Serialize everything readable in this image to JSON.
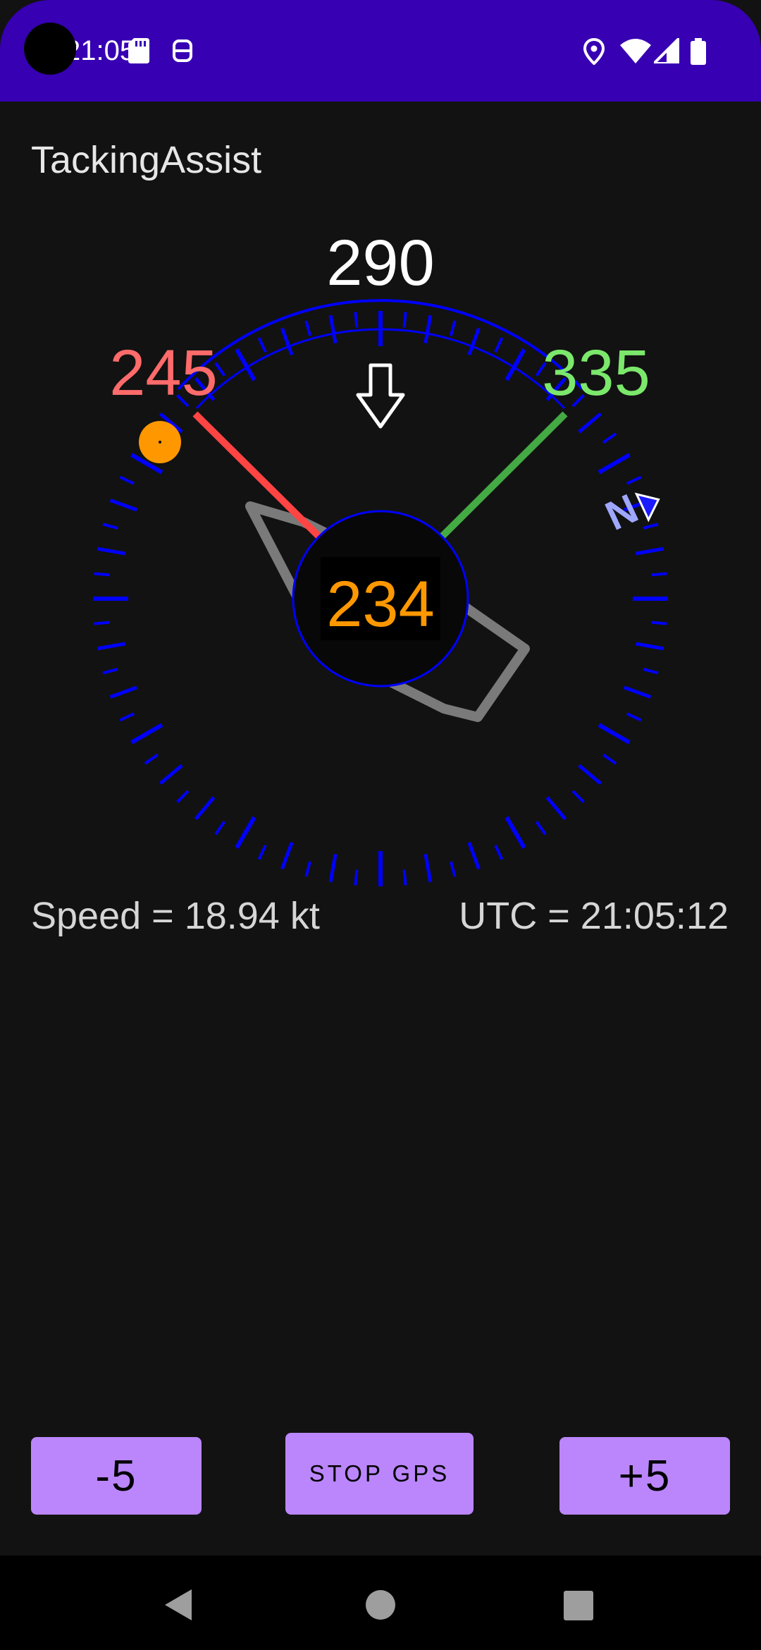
{
  "status_bar": {
    "time": "21:05",
    "icons": [
      "sd-card-icon",
      "robot-icon",
      "location-icon",
      "wifi-icon",
      "signal-icon",
      "battery-icon"
    ]
  },
  "app": {
    "title": "TackingAssist"
  },
  "compass": {
    "target_heading": "290",
    "port_tack": "245",
    "starboard_tack": "335",
    "current_heading": "234",
    "north_label": "N",
    "colors": {
      "ring": "#0000ff",
      "port": "#ff4444",
      "starboard": "#44aa44",
      "heading": "#ff9800",
      "boat": "#7a7a7a"
    }
  },
  "info": {
    "speed": "Speed = 18.94 kt",
    "utc": "UTC = 21:05:12"
  },
  "buttons": {
    "minus": "-5",
    "stop_gps": "STOP GPS",
    "plus": "+5"
  },
  "nav": {
    "icons": [
      "back-icon",
      "home-icon",
      "recents-icon"
    ]
  }
}
